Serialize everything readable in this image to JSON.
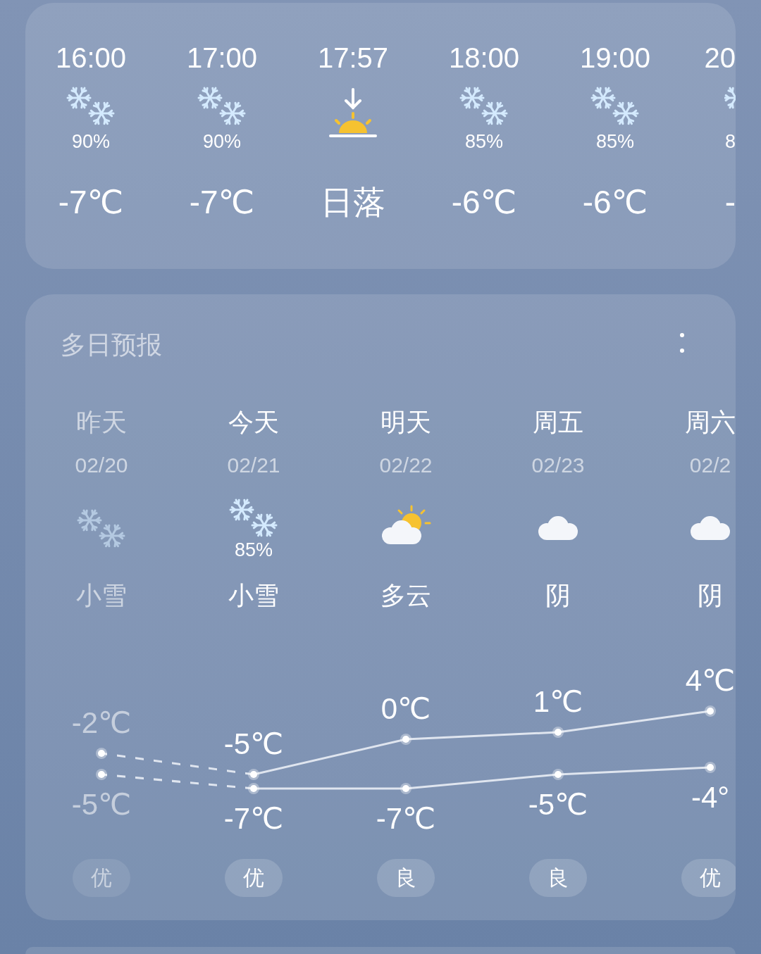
{
  "hourly": [
    {
      "time": "16:00",
      "kind": "snow",
      "precip": "90%",
      "temp": "-7℃"
    },
    {
      "time": "17:00",
      "kind": "snow",
      "precip": "90%",
      "temp": "-7℃"
    },
    {
      "time": "17:57",
      "kind": "sunset",
      "temp": "日落"
    },
    {
      "time": "18:00",
      "kind": "snow",
      "precip": "85%",
      "temp": "-6℃"
    },
    {
      "time": "19:00",
      "kind": "snow",
      "precip": "85%",
      "temp": "-6℃"
    },
    {
      "time": "20",
      "kind": "snow",
      "precip": "8",
      "temp": "-"
    }
  ],
  "daily": {
    "title": "多日预报",
    "days": [
      {
        "name": "昨天",
        "date": "02/20",
        "kind": "snow",
        "condition": "小雪",
        "aqi": "优",
        "past": true
      },
      {
        "name": "今天",
        "date": "02/21",
        "kind": "snow",
        "precip": "85%",
        "condition": "小雪",
        "aqi": "优",
        "past": false
      },
      {
        "name": "明天",
        "date": "02/22",
        "kind": "partly_cloudy",
        "condition": "多云",
        "aqi": "良",
        "past": false
      },
      {
        "name": "周五",
        "date": "02/23",
        "kind": "cloudy",
        "condition": "阴",
        "aqi": "良",
        "past": false
      },
      {
        "name": "周六",
        "date": "02/2",
        "kind": "cloudy",
        "condition": "阴",
        "aqi": "优",
        "past": false
      }
    ],
    "chart_data": {
      "type": "line",
      "categories": [
        null,
        null,
        null,
        null,
        null
      ],
      "series": [
        {
          "color": "#dfe5ef",
          "marker": "circle",
          "values": [
            -2,
            -5,
            0,
            1,
            4
          ],
          "value_labels": [
            "-2℃",
            "-5℃",
            "0℃",
            "1℃",
            "4℃"
          ]
        },
        {
          "color": "#dfe5ef",
          "marker": "circle",
          "values": [
            -5,
            -7,
            -7,
            -5,
            -4
          ],
          "value_labels": [
            "-5℃",
            "-7℃",
            "-7℃",
            "-5℃",
            "-4°"
          ]
        }
      ]
    }
  }
}
